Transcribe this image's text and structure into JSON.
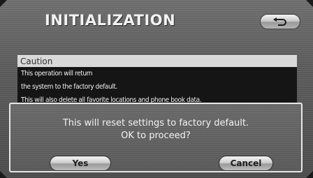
{
  "screen": {
    "title": "INITIALIZATION",
    "back_icon": "return-arrow-icon"
  },
  "caution": {
    "header": "Caution",
    "lines": [
      "This operation will return",
      "the system to the factory default.",
      "This will also delete all favorite locations and phone book data."
    ]
  },
  "dialog": {
    "message_line1": "This will reset settings to factory default.",
    "message_line2": "OK to proceed?",
    "yes_label": "Yes",
    "cancel_label": "Cancel"
  },
  "colors": {
    "background": "#5c5c5c",
    "caution_header": "#d9d9d9",
    "caution_body": "#151515",
    "text_light": "#f2f2f2"
  }
}
